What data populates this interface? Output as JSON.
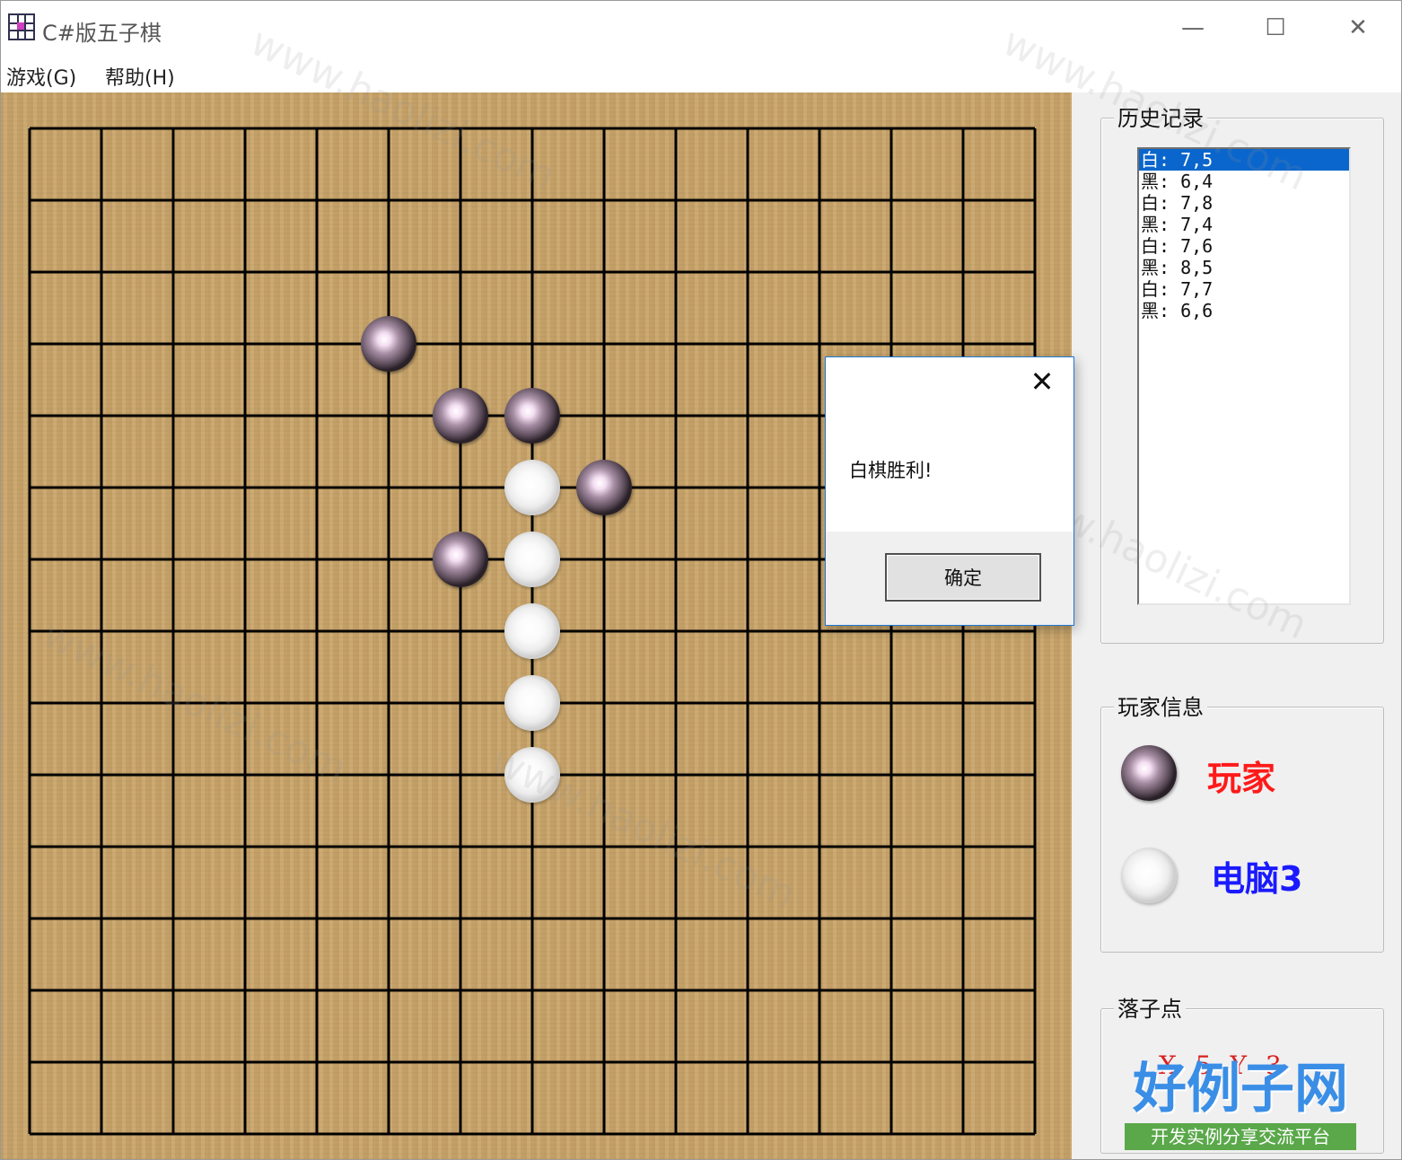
{
  "window": {
    "title": "C#版五子棋",
    "buttons": {
      "minimize": "—",
      "maximize": "☐",
      "close": "✕"
    }
  },
  "menu": [
    "游戏(G)",
    "帮助(H)"
  ],
  "board": {
    "lines": 15,
    "stones": [
      {
        "color": "black",
        "col": 5,
        "row": 3
      },
      {
        "color": "black",
        "col": 6,
        "row": 4
      },
      {
        "color": "black",
        "col": 7,
        "row": 4
      },
      {
        "color": "white",
        "col": 7,
        "row": 5
      },
      {
        "color": "black",
        "col": 8,
        "row": 5
      },
      {
        "color": "black",
        "col": 6,
        "row": 6
      },
      {
        "color": "white",
        "col": 7,
        "row": 6
      },
      {
        "color": "white",
        "col": 7,
        "row": 7
      },
      {
        "color": "white",
        "col": 7,
        "row": 8
      },
      {
        "color": "white",
        "col": 7,
        "row": 9
      }
    ]
  },
  "history": {
    "title": "历史记录",
    "items": [
      "白: 7,5",
      "黑: 6,4",
      "白: 7,8",
      "黑: 7,4",
      "白: 7,6",
      "黑: 8,5",
      "白: 7,7",
      "黑: 6,6"
    ],
    "selected_index": 0
  },
  "players": {
    "title": "玩家信息",
    "human": {
      "label": "玩家",
      "color": "#ff1a1a"
    },
    "computer": {
      "label": "电脑3",
      "color": "#1a1aff"
    }
  },
  "drop_point": {
    "title": "落子点",
    "text": "X 5 Y 3"
  },
  "dialog": {
    "message": "白棋胜利!",
    "ok_label": "确定",
    "close_icon": "✕"
  },
  "watermark": {
    "title": "好例子网",
    "subtitle": "开发实例分享交流平台",
    "text": "www.haolizi.com"
  }
}
